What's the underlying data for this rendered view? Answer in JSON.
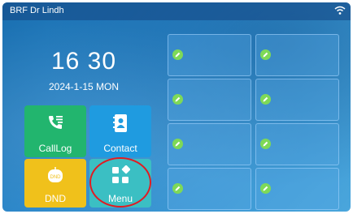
{
  "status_bar": {
    "account": "BRF Dr Lindh",
    "wifi_icon": "wifi-icon"
  },
  "clock": {
    "time": "16 30",
    "date": "2024-1-15 MON"
  },
  "tiles": [
    {
      "label": "CallLog",
      "icon": "call-log-icon",
      "color": "#22b56e"
    },
    {
      "label": "Contact",
      "icon": "contact-book-icon",
      "color": "#1f9be0"
    },
    {
      "label": "DND",
      "icon": "dnd-icon",
      "color": "#f0c11b"
    },
    {
      "label": "Menu",
      "icon": "menu-grid-icon",
      "color": "#3bbfc3"
    }
  ],
  "highlight": {
    "target": "Menu",
    "color": "#e11b22"
  },
  "dss_keys": {
    "count": 8,
    "icon": "edit-pen-icon",
    "accent": "#7ed957"
  }
}
